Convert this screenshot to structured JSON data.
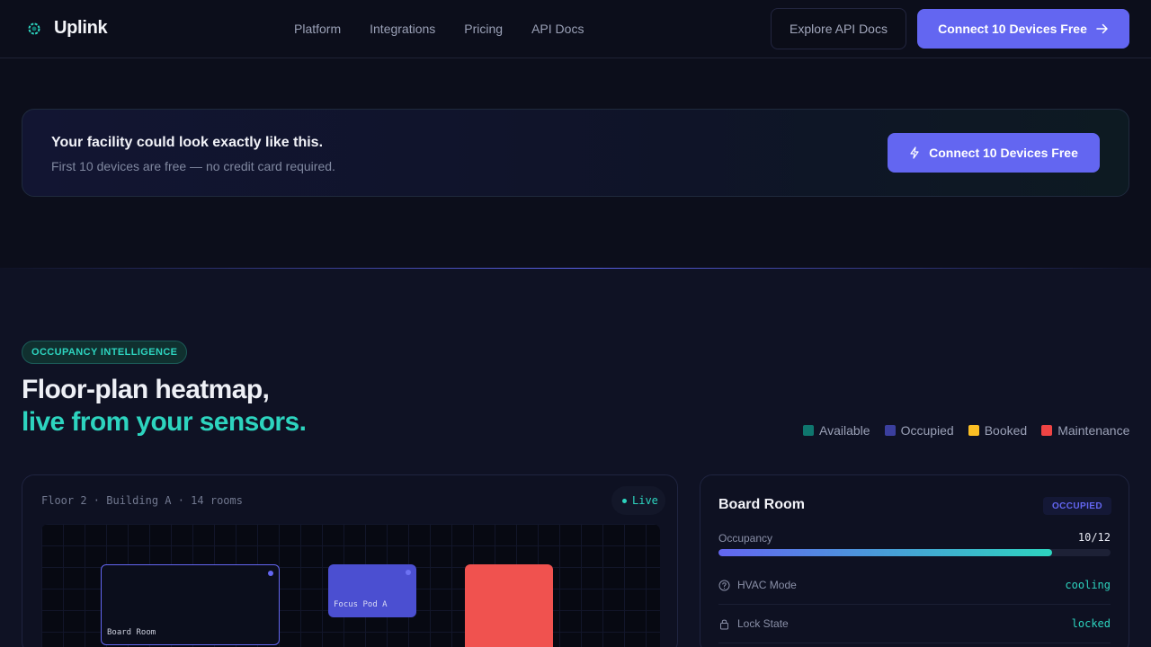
{
  "nav": {
    "brand": "Uplink",
    "links": [
      "Platform",
      "Integrations",
      "Pricing",
      "API Docs"
    ],
    "secondary_cta": "Explore API Docs",
    "primary_cta": "Connect 10 Devices Free",
    "primary_cta_icon": "arrow-right-icon"
  },
  "cta_banner": {
    "title": "Your facility could look exactly like this.",
    "subtitle": "First 10 devices are free — no credit card required.",
    "button": "Connect 10 Devices Free",
    "button_icon": "lightning-icon"
  },
  "section": {
    "badge": "OCCUPANCY INTELLIGENCE",
    "headline_line1": "Floor-plan heatmap,",
    "headline_line2": "live from your sensors.",
    "legend": [
      {
        "label": "Available",
        "color": "#0f766e"
      },
      {
        "label": "Occupied",
        "color": "#3b3f9e"
      },
      {
        "label": "Booked",
        "color": "#fbbf24"
      },
      {
        "label": "Maintenance",
        "color": "#ef4444"
      }
    ]
  },
  "floor": {
    "label": "Floor 2 · Building A · 14 rooms",
    "live": "Live",
    "rooms": [
      {
        "name": "Board Room",
        "status": "selected"
      },
      {
        "name": "Focus Pod A",
        "status": "occupied"
      },
      {
        "name": "",
        "status": "maintenance"
      }
    ]
  },
  "detail": {
    "title": "Board Room",
    "status": "OCCUPIED",
    "occupancy_label": "Occupancy",
    "occupancy_value": "10/12",
    "occupancy_fraction": 0.85,
    "rows": [
      {
        "label": "HVAC Mode",
        "value": "cooling",
        "icon": "help-circle-icon"
      },
      {
        "label": "Lock State",
        "value": "locked",
        "icon": "lock-icon"
      }
    ]
  },
  "colors": {
    "accent": "#6366f1",
    "teal": "#2dd4bf",
    "background": "#0c0e1b"
  }
}
